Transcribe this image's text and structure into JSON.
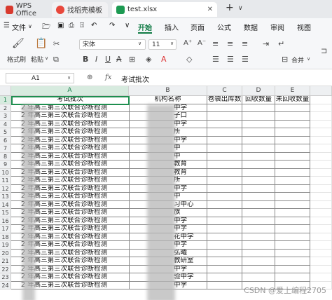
{
  "tabs": [
    {
      "label": "WPS Office",
      "icon": "wps-logo-icon"
    },
    {
      "label": "找稻壳模板",
      "icon": "docer-template-icon"
    },
    {
      "label": "test.xlsx",
      "icon": "spreadsheet-file-icon",
      "active": true
    }
  ],
  "new_tab": "+",
  "new_tab_menu": "∨",
  "menu": {
    "file_label": "文件",
    "items": [
      "开始",
      "插入",
      "页面",
      "公式",
      "数据",
      "审阅",
      "视图"
    ],
    "active": "开始"
  },
  "ribbon": {
    "format_painter": "格式刷",
    "paste": "粘贴",
    "font_name": "宋体",
    "font_size": "11",
    "merge": "合并"
  },
  "formula_bar": {
    "cell_ref": "A1",
    "fx": "fx",
    "content": "考试批次"
  },
  "sheet": {
    "columns": [
      "A",
      "B",
      "C",
      "D",
      "E"
    ],
    "selected_column": "A",
    "selected_row": 1,
    "headers": [
      "考试批次",
      "机构名称",
      "卷袋出库数",
      "回收数量",
      "未回收数量"
    ],
    "row_numbers": [
      "1",
      "2",
      "3",
      "4",
      "5",
      "6",
      "7",
      "8",
      "9",
      "10",
      "11",
      "12",
      "13",
      "14",
      "15",
      "16",
      "17",
      "18",
      "19",
      "20",
      "21",
      "22",
      "23",
      "24"
    ],
    "rows": [
      {
        "a": "2      年高三第三次联合诊断检测",
        "b": "中学"
      },
      {
        "a": "2      年高三第三次联合诊断检测",
        "b": "子口"
      },
      {
        "a": "2      年高三第三次联合诊断检测",
        "b": "中学"
      },
      {
        "a": "2      年高三第三次联合诊断检测",
        "b": "所"
      },
      {
        "a": "2      年高三第三次联合诊断检测",
        "b": "中学"
      },
      {
        "a": "2      年高三第三次联合诊断检测",
        "b": "中"
      },
      {
        "a": "2      年高三第三次联合诊断检测",
        "b": "中"
      },
      {
        "a": "2      年高三第三次联合诊断检测",
        "b": "教育"
      },
      {
        "a": "2      年高三第三次联合诊断检测",
        "b": "教育"
      },
      {
        "a": "2      年高三第三次联合诊断检测",
        "b": "所"
      },
      {
        "a": "2      年高三第三次联合诊断检测",
        "b": "中学"
      },
      {
        "a": "2      年高三第三次联合诊断检测",
        "b": "中"
      },
      {
        "a": "2      年高三第三次联合诊断检测",
        "b": "习中心"
      },
      {
        "a": "2      年高三第三次联合诊断检测",
        "b": "族"
      },
      {
        "a": "2      年高三第三次联合诊断检测",
        "b": "中学"
      },
      {
        "a": "2      年高三第三次联合诊断检测",
        "b": "中学"
      },
      {
        "a": "2      年高三第三次联合诊断检测",
        "b": "花中学"
      },
      {
        "a": "2      年高三第三次联合诊断检测",
        "b": "中学"
      },
      {
        "a": "2      年高三第三次联合诊断检测",
        "b": "弘曦"
      },
      {
        "a": "2      年高三第三次联合诊断检测",
        "b": "教研室"
      },
      {
        "a": "2      年高三第三次联合诊断检测",
        "b": "中学"
      },
      {
        "a": "2      年高三第三次联合诊断检测",
        "b": "验中学"
      },
      {
        "a": "2      年高三第三次联合诊断检测",
        "b": "中学"
      }
    ]
  },
  "watermark": "CSDN @爱上编程2705"
}
